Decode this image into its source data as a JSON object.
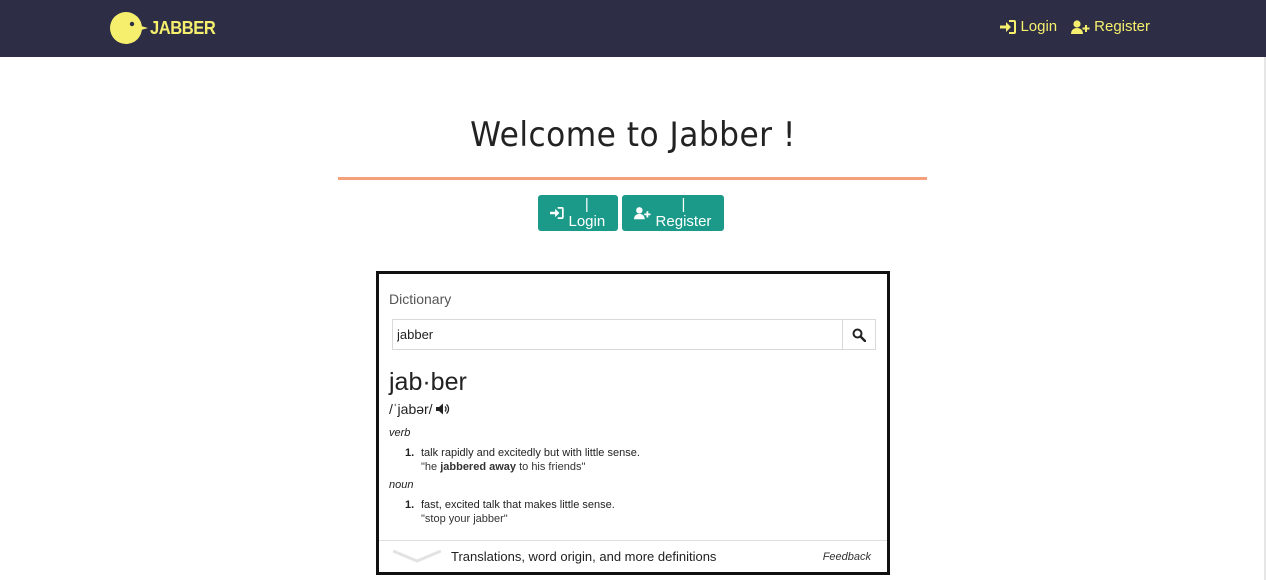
{
  "navbar": {
    "brand": "JABBER",
    "links": [
      {
        "label": "Login",
        "icon": "sign-in-icon"
      },
      {
        "label": "Register",
        "icon": "user-plus-icon"
      }
    ],
    "brand_color": "#f6ef6e",
    "background": "#2d2d45"
  },
  "hero": {
    "title": "Welcome to Jabber !",
    "rule_color": "#f4a07a",
    "buttons": [
      {
        "label": "| Login",
        "icon": "sign-in-icon"
      },
      {
        "label": "| Register",
        "icon": "user-plus-icon"
      }
    ],
    "button_color": "#1b9a8a"
  },
  "dictionary": {
    "heading": "Dictionary",
    "search_value": "jabber",
    "word": "jab·ber",
    "phonetic": "/ˈjabər/",
    "entries": [
      {
        "pos": "verb",
        "num": "1.",
        "definition": "talk rapidly and excitedly but with little sense.",
        "example_prefix": "\"he ",
        "example_bold": "jabbered away",
        "example_suffix": " to his friends\""
      },
      {
        "pos": "noun",
        "num": "1.",
        "definition": "fast, excited talk that makes little sense.",
        "example": "\"stop your jabber\""
      }
    ],
    "footer_link": "Translations, word origin, and more definitions",
    "feedback": "Feedback"
  }
}
